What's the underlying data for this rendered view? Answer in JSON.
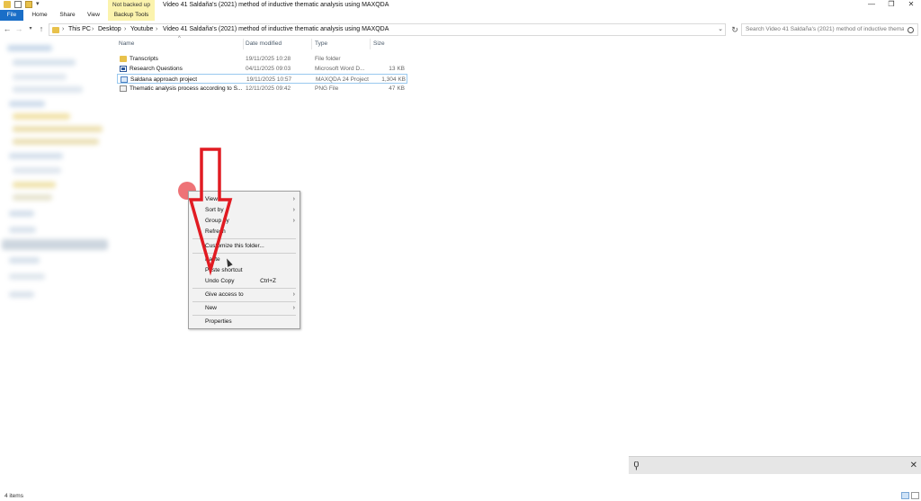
{
  "window": {
    "title": "Video 41 Saldaña's (2021) method of inductive thematic analysis using MAXQDA",
    "title_tag": "Not backed up",
    "controls": {
      "minimize": "—",
      "restore": "❐",
      "close": "✕"
    }
  },
  "ribbon": {
    "tabs": [
      "File",
      "Home",
      "Share",
      "View",
      "Backup Tools"
    ],
    "active": "File"
  },
  "address": {
    "crumbs": [
      "This PC",
      "Desktop",
      "Youtube",
      "Video 41 Saldaña's (2021) method of inductive thematic analysis using MAXQDA"
    ],
    "search_placeholder": "Search Video 41 Saldaña's (2021) method of inductive themati..."
  },
  "columns": {
    "name": "Name",
    "date": "Date modified",
    "type": "Type",
    "size": "Size"
  },
  "files": [
    {
      "name": "Transcripts",
      "date": "19/11/2025 10:28",
      "type": "File folder",
      "size": "",
      "icon": "folder-icon"
    },
    {
      "name": "Research Questions",
      "date": "04/11/2025 09:03",
      "type": "Microsoft Word D...",
      "size": "13 KB",
      "icon": "word-document-icon"
    },
    {
      "name": "Saldana approach project",
      "date": "19/11/2025 10:57",
      "type": "MAXQDA 24 Project",
      "size": "1,304 KB",
      "icon": "maxqda-project-icon"
    },
    {
      "name": "Thematic analysis process according to S...",
      "date": "12/11/2025 09:42",
      "type": "PNG File",
      "size": "47 KB",
      "icon": "png-image-icon"
    }
  ],
  "context_menu": {
    "items": [
      {
        "label": "View",
        "submenu": true
      },
      {
        "label": "Sort by",
        "submenu": true
      },
      {
        "label": "Group by",
        "submenu": true
      },
      {
        "label": "Refresh"
      },
      {
        "label": "Customize this folder..."
      },
      {
        "label": "Paste"
      },
      {
        "label": "Paste shortcut"
      },
      {
        "label": "Undo Copy",
        "shortcut": "Ctrl+Z"
      },
      {
        "label": "Give access to",
        "submenu": true
      },
      {
        "label": "New",
        "submenu": true
      },
      {
        "label": "Properties"
      }
    ]
  },
  "status": {
    "item_count": "4 items"
  },
  "colors": {
    "accent": "#1a6ec7",
    "tag_bg": "#fbf3ad",
    "annotation_red": "#e11b22",
    "click_indicator": "#eb5a5f"
  }
}
